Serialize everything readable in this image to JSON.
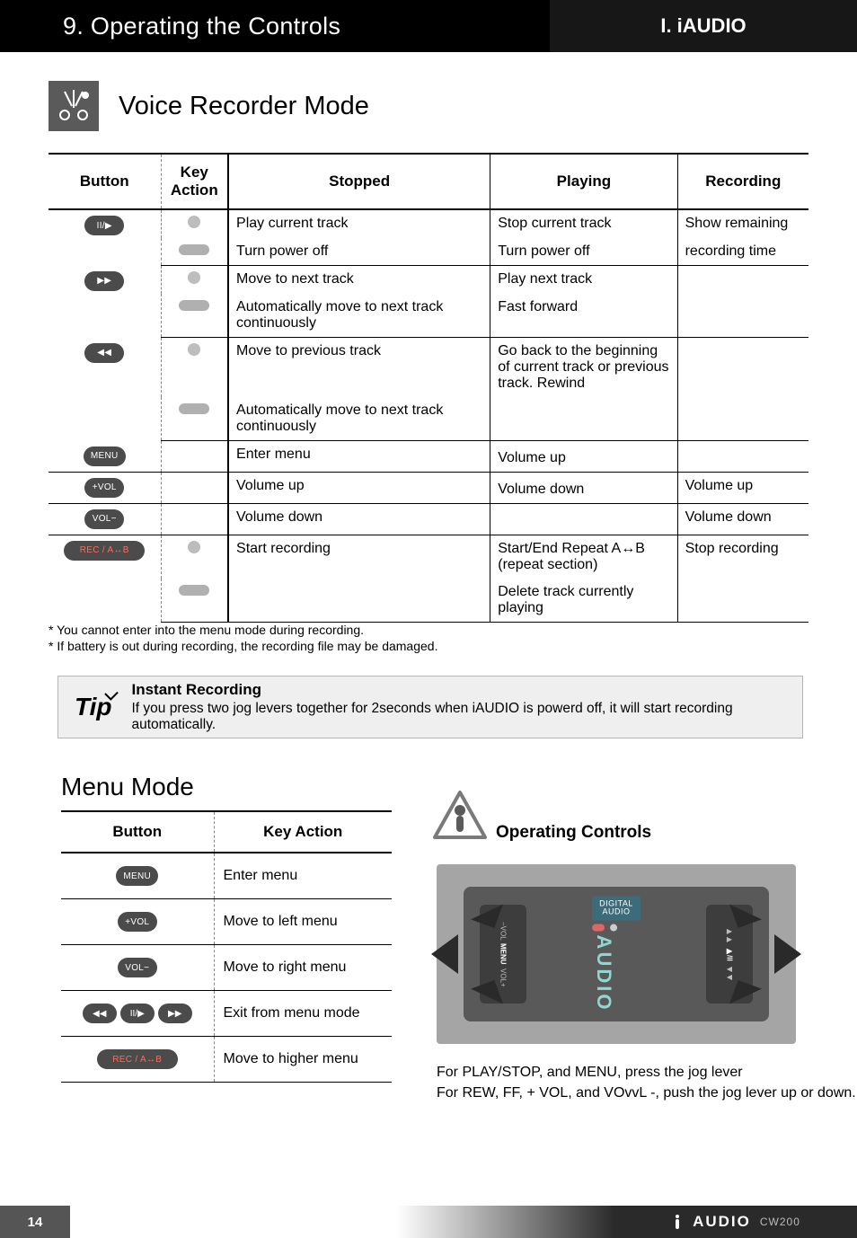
{
  "header": {
    "chapter": "9. Operating the Controls",
    "part": "I. iAUDIO"
  },
  "section_voice": "Voice Recorder Mode",
  "vr_table": {
    "headers": {
      "button": "Button",
      "key": "Key Action",
      "stopped": "Stopped",
      "playing": "Playing",
      "recording": "Recording"
    },
    "rows": [
      {
        "icon": "II/▶",
        "key": "dot",
        "stopped": "Play current track",
        "playing": "Stop current track",
        "recording": "Show remaining"
      },
      {
        "icon": "",
        "key": "bar",
        "stopped": "Turn power off",
        "playing": "Turn power off",
        "recording": "recording time"
      },
      {
        "icon": "▶▶",
        "key": "dot",
        "stopped": "Move to next track",
        "playing": "Play next track",
        "recording": ""
      },
      {
        "icon": "",
        "key": "bar",
        "stopped": "Automatically move to next track continuously",
        "playing": "Fast forward",
        "recording": ""
      },
      {
        "icon": "◀◀",
        "key": "dot",
        "stopped": "Move to previous track",
        "playing": "Go back to the beginning of current track or previous track. Rewind",
        "recording": ""
      },
      {
        "icon": "",
        "key": "bar",
        "stopped": "Automatically move to next track continuously",
        "playing": "",
        "recording": ""
      },
      {
        "icon": "MENU",
        "key": "",
        "stopped": "Enter menu",
        "playing": "Volume up",
        "recording": ""
      },
      {
        "icon": "+VOL",
        "key": "",
        "stopped": "Volume up",
        "playing": "Volume down",
        "recording": "Volume up"
      },
      {
        "icon": "VOL−",
        "key": "",
        "stopped": "Volume down",
        "playing": "",
        "recording": "Volume down"
      },
      {
        "icon": "REC / A↔B",
        "key": "dot",
        "stopped": "Start recording",
        "playing": "Start/End Repeat A↔B (repeat section)",
        "recording": "Stop recording"
      },
      {
        "icon": "",
        "key": "bar",
        "stopped": "",
        "playing": "Delete track currently playing",
        "recording": ""
      }
    ]
  },
  "footnotes": [
    "* You cannot enter into the menu mode during recording.",
    "* If battery is out during recording, the recording file may be damaged."
  ],
  "tip": {
    "label": "Tip",
    "title": "Instant Recording",
    "text": "If you press two jog levers together for 2seconds when iAUDIO is powerd off, it will start recording automatically."
  },
  "section_menu": "Menu Mode",
  "mm_table": {
    "headers": {
      "button": "Button",
      "key": "Key Action"
    },
    "rows": [
      {
        "icon": "MENU",
        "action": "Enter menu"
      },
      {
        "icon": "+VOL",
        "action": "Move to left menu"
      },
      {
        "icon": "VOL−",
        "action": "Move to right menu"
      },
      {
        "icon": "group",
        "action": "Exit from menu mode"
      },
      {
        "icon": "REC / A↔B",
        "action": "Move to higher menu"
      }
    ]
  },
  "oc": {
    "title": "Operating Controls",
    "device": {
      "digital": "DIGITAL",
      "audio_small": "AUDIO",
      "audio_big": "AUDIO",
      "lbl_volminus": "−VOL",
      "lbl_menu": "MENU",
      "lbl_volplus": "VOL+",
      "lbl_ff": "▶▶",
      "lbl_play": "▶/II",
      "lbl_rew": "◀◀"
    },
    "line1": "For PLAY/STOP, and MENU, press the jog lever",
    "line2": "For REW, FF, + VOL, and VOvvL -, push the jog lever up or down."
  },
  "footer": {
    "page": "14",
    "brand": "AUDIO",
    "model": "CW200"
  }
}
